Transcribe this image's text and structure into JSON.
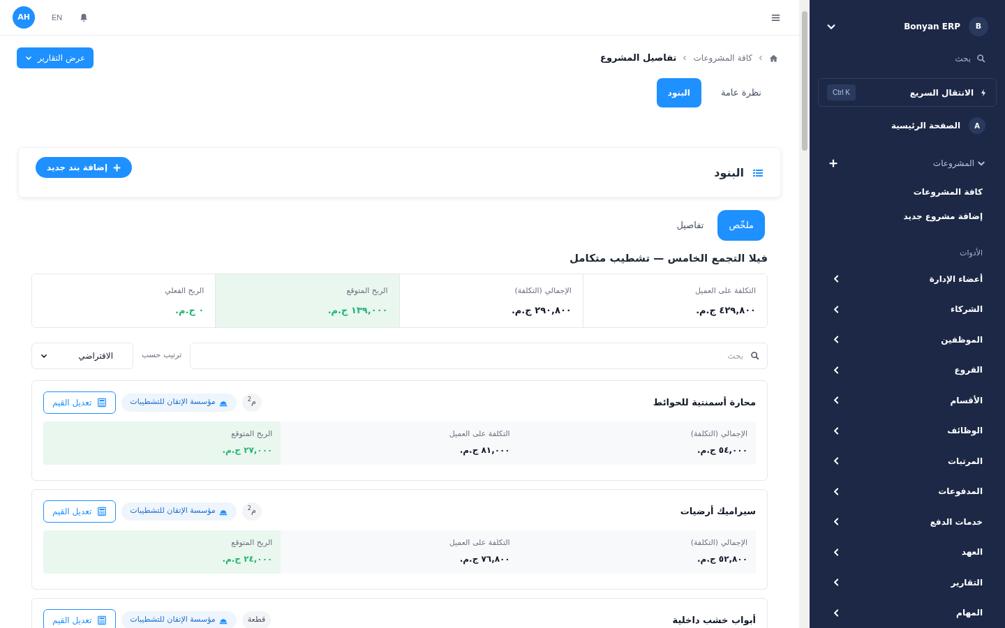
{
  "topbar": {
    "avatar": "AH",
    "language": "EN"
  },
  "breadcrumb": [
    "كافة المشروعات",
    "تفاصيل المشروع"
  ],
  "reports_button": "عرض التقارير",
  "tabs": [
    {
      "label": "نظرة عامة",
      "selected": false
    },
    {
      "label": "البنود",
      "selected": true
    }
  ],
  "section": {
    "title": "البنود",
    "add_button": "إضافة بند جديد"
  },
  "view_tabs": [
    {
      "label": "ملخّص",
      "selected": true
    },
    {
      "label": "تفاصيل",
      "selected": false
    }
  ],
  "project_title": "فيلا التجمع الخامس — تشطيب متكامل",
  "summary": [
    {
      "label": "التكلفة على العميل",
      "value": "٤٢٩,٨٠٠ ج.م.",
      "highlight": false,
      "positive": false
    },
    {
      "label": "الإجمالي (التكلفة)",
      "value": "٢٩٠,٨٠٠ ج.م.",
      "highlight": false,
      "positive": false
    },
    {
      "label": "الربح المتوقع",
      "value": "١٣٩,٠٠٠ ج.م.",
      "highlight": true,
      "positive": true
    },
    {
      "label": "الربح الفعلي",
      "value": "٠ ج.م.",
      "highlight": false,
      "positive": true
    }
  ],
  "filter": {
    "search_placeholder": "بحث",
    "sort_label": "ترتيب حسب",
    "sort_value": "الافتراضي"
  },
  "items": [
    {
      "name": "محارة أسمنتية للحوائط",
      "unit": "م$^{2}$",
      "contractor": "مؤسسة الإتقان للتشطيبات",
      "edit_button": "تعديل القيم",
      "stats": [
        {
          "label": "الإجمالي (التكلفة)",
          "value": "٥٤,٠٠٠ ج.م.",
          "highlight": false
        },
        {
          "label": "التكلفة على العميل",
          "value": "٨١,٠٠٠ ج.م.",
          "highlight": false
        },
        {
          "label": "الربح المتوقع",
          "value": "٢٧,٠٠٠ ج.م.",
          "highlight": true
        }
      ]
    },
    {
      "name": "سيراميك أرضيات",
      "unit": "م$^{2}$",
      "contractor": "مؤسسة الإتقان للتشطيبات",
      "edit_button": "تعديل القيم",
      "stats": [
        {
          "label": "الإجمالي (التكلفة)",
          "value": "٥٢,٨٠٠ ج.م.",
          "highlight": false
        },
        {
          "label": "التكلفة على العميل",
          "value": "٧٦,٨٠٠ ج.م.",
          "highlight": false
        },
        {
          "label": "الربح المتوقع",
          "value": "٢٤,٠٠٠ ج.م.",
          "highlight": true
        }
      ]
    },
    {
      "name": "أبواب خشب داخلية",
      "unit": "قطعة",
      "contractor": "مؤسسة الإتقان للتشطيبات",
      "edit_button": "تعديل القيم"
    }
  ],
  "sidebar": {
    "brand": {
      "initial": "B",
      "name": "Bonyan ERP"
    },
    "search_placeholder": "بحث",
    "quick_jump": {
      "label": "الانتقال السريع",
      "shortcut": "Ctrl K"
    },
    "home": {
      "initial": "A",
      "label": "الصفحة الرئيسية"
    },
    "projects": {
      "label": "المشروعات",
      "expanded": true,
      "children": [
        {
          "label": "كافة المشروعات"
        },
        {
          "label": "إضافة مشروع جديد"
        }
      ]
    },
    "tools_heading": "الأدوات",
    "items": [
      {
        "label": "أعضاء الإدارة"
      },
      {
        "label": "الشركاء"
      },
      {
        "label": "الموظفين"
      },
      {
        "label": "الفروع"
      },
      {
        "label": "الأقسام"
      },
      {
        "label": "الوظائف"
      },
      {
        "label": "المرتبات"
      },
      {
        "label": "المدفوعات"
      },
      {
        "label": "خدمات الدفع"
      },
      {
        "label": "العهد"
      },
      {
        "label": "التقارير"
      },
      {
        "label": "المهام"
      }
    ]
  }
}
